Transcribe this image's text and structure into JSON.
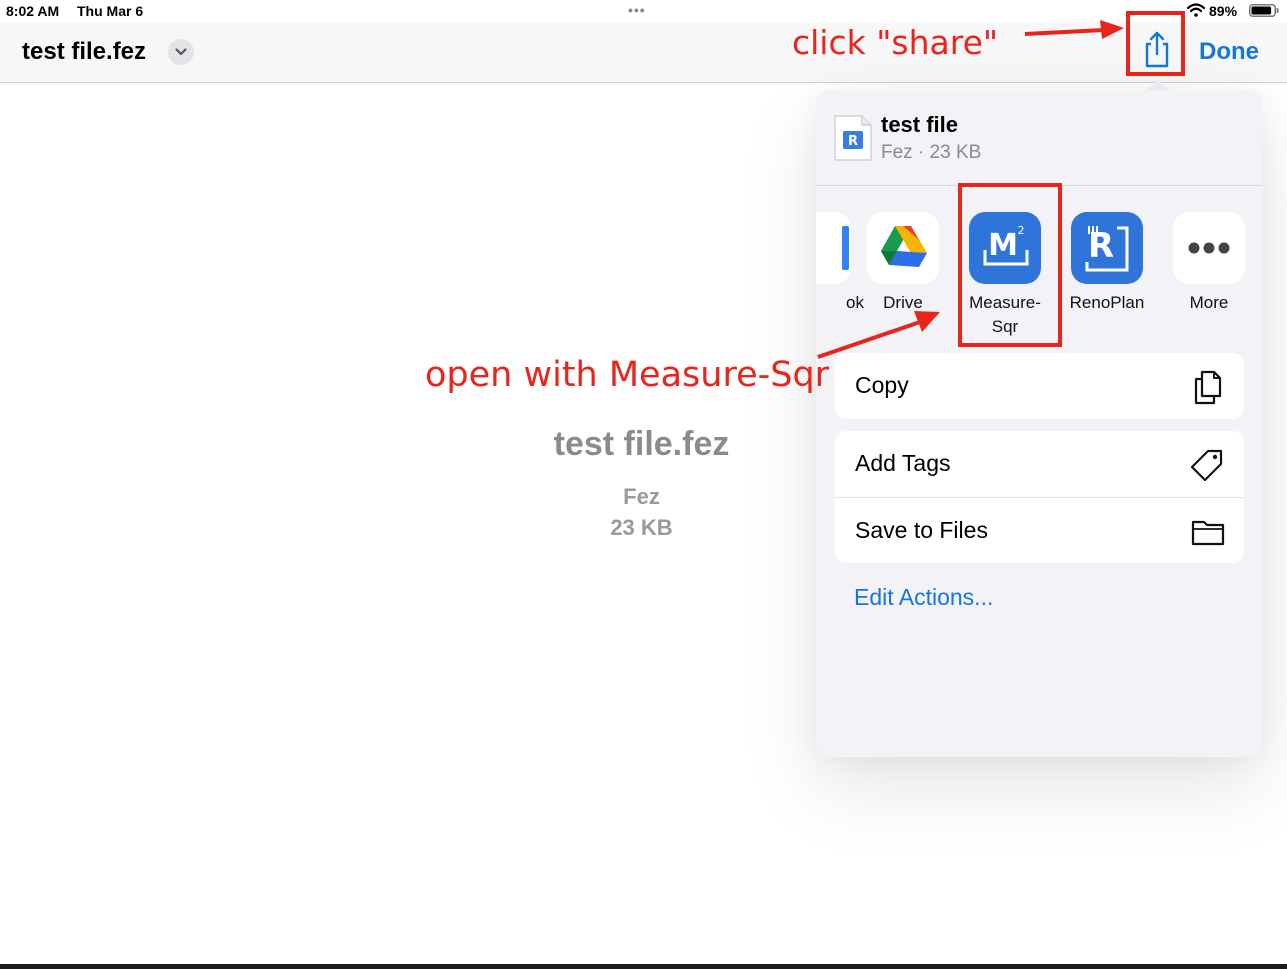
{
  "status_bar": {
    "time": "8:02 AM",
    "date": "Thu Mar 6",
    "multitask_dots": "•••",
    "battery_percent": "89%",
    "battery_level": 0.89
  },
  "nav": {
    "title": "test file.fez",
    "done_label": "Done"
  },
  "preview": {
    "filename": "test file.fez",
    "kind": "Fez",
    "size": "23 KB"
  },
  "share_sheet": {
    "file_name": "test file",
    "file_meta": "Fez · 23 KB",
    "apps": [
      {
        "label": "ok",
        "icon": "book-app-icon"
      },
      {
        "label": "Drive",
        "icon": "google-drive-icon"
      },
      {
        "label": "Measure-\nSqr",
        "icon": "measure-sqr-icon"
      },
      {
        "label": "RenoPlan",
        "icon": "renoplan-icon"
      },
      {
        "label": "More",
        "icon": "more-icon"
      }
    ],
    "actions": [
      {
        "label": "Copy",
        "icon": "copy-icon"
      },
      {
        "label": "Add Tags",
        "icon": "tag-icon"
      },
      {
        "label": "Save to Files",
        "icon": "folder-icon"
      }
    ],
    "edit_actions": "Edit Actions..."
  },
  "annotations": {
    "click_share": "click \"share\"",
    "open_with": "open with Measure-Sqr"
  },
  "colors": {
    "accent": "#1676d9",
    "annotation": "#e8251b",
    "sheet_background": "#f2f2f7"
  }
}
